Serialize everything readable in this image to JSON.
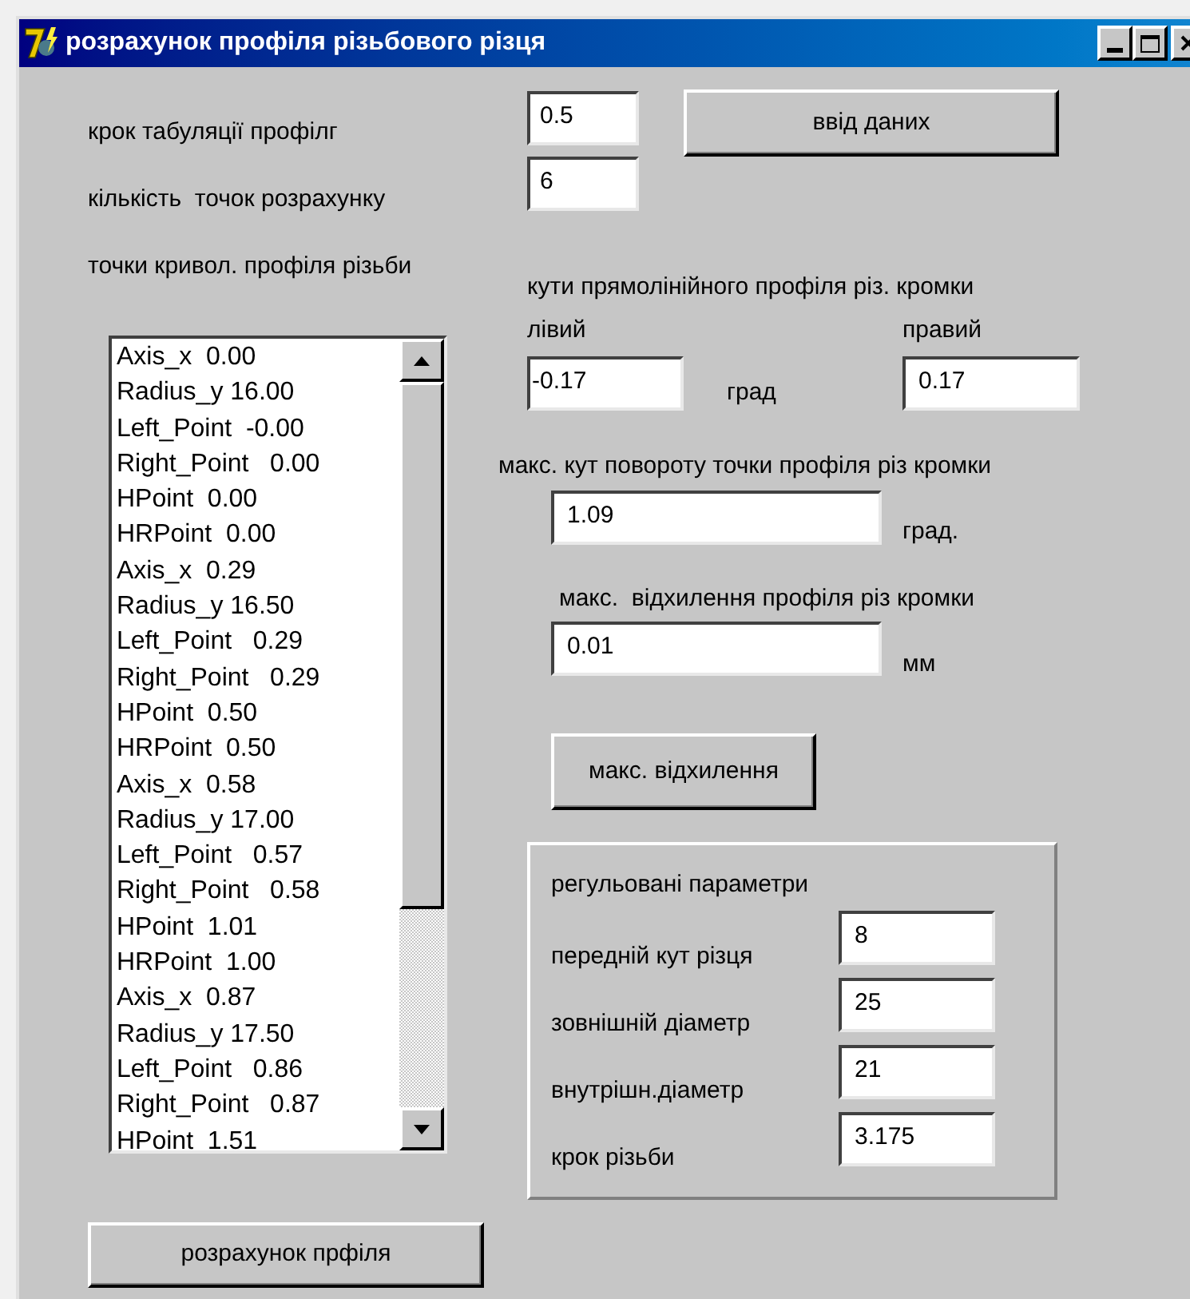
{
  "window": {
    "title": "розрахунок профіля різьбового різця"
  },
  "input_section": {
    "button": "ввід даних",
    "fields": [
      {
        "label": "крок табуляції профілг",
        "value": "0.5"
      },
      {
        "label": "кількість  точок розрахунку",
        "value": "6"
      }
    ]
  },
  "points_list": {
    "label": "точки кривол. профіля різьби",
    "items": [
      "Axis_x  0.00",
      "Radius_y 16.00",
      "Left_Point  -0.00",
      "Right_Point   0.00",
      "HPoint  0.00",
      "HRPoint  0.00",
      "Axis_x  0.29",
      "Radius_y 16.50",
      "Left_Point   0.29",
      "Right_Point   0.29",
      "HPoint  0.50",
      "HRPoint  0.50",
      "Axis_x  0.58",
      "Radius_y 17.00",
      "Left_Point   0.57",
      "Right_Point   0.58",
      "HPoint  1.01",
      "HRPoint  1.00",
      "Axis_x  0.87",
      "Radius_y 17.50",
      "Left_Point   0.86",
      "Right_Point   0.87",
      "HPoint  1.51"
    ]
  },
  "calculate_button": "розрахунок прфіля",
  "straight_profile_angles": {
    "label": "кути прямолінійного профіля різ. кромки",
    "left": {
      "label": "лівий",
      "value": "-0.17"
    },
    "unit": "град",
    "right": {
      "label": "правий",
      "value": "0.17"
    }
  },
  "max_rotation_angle": {
    "label": "макс. кут повороту точки профіля різ кромки",
    "value": "1.09",
    "unit": "град."
  },
  "max_deviation": {
    "label": "макс.  відхилення профіля різ кромки",
    "value": "0.01",
    "unit": "мм"
  },
  "max_deviation_button": "макс. відхилення",
  "adjustable_parameters": {
    "title": "регульовані параметри",
    "fields": [
      {
        "label": "передній кут різця",
        "value": "8"
      },
      {
        "label": "зовнішній діаметр",
        "value": "25"
      },
      {
        "label": "внутрішн.діаметр",
        "value": "21"
      },
      {
        "label": "крок різьби",
        "value": "3.175"
      }
    ]
  }
}
